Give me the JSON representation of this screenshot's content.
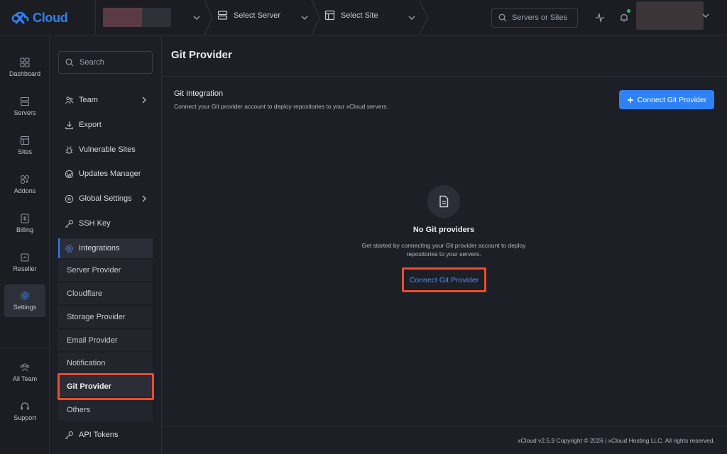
{
  "brand": {
    "name": "Cloud",
    "accent": "#2f82f6"
  },
  "topbar": {
    "server_label": "Select Server",
    "site_label": "Select Site",
    "search_placeholder": "Servers or Sites"
  },
  "rail": {
    "items": [
      {
        "label": "Dashboard",
        "icon": "grid-icon"
      },
      {
        "label": "Servers",
        "icon": "server-icon"
      },
      {
        "label": "Sites",
        "icon": "layout-icon"
      },
      {
        "label": "Addons",
        "icon": "addons-icon"
      },
      {
        "label": "Billing",
        "icon": "billing-icon"
      },
      {
        "label": "Reseller",
        "icon": "reseller-icon"
      },
      {
        "label": "Settings",
        "icon": "gear-icon"
      },
      {
        "label": "All Team",
        "icon": "team-icon"
      },
      {
        "label": "Support",
        "icon": "headset-icon"
      }
    ]
  },
  "sidebar": {
    "search_placeholder": "Search",
    "items": [
      {
        "label": "Team"
      },
      {
        "label": "Export"
      },
      {
        "label": "Vulnerable Sites"
      },
      {
        "label": "Updates Manager"
      },
      {
        "label": "Global Settings"
      },
      {
        "label": "SSH Key"
      },
      {
        "label": "Integrations"
      },
      {
        "label": "API Tokens"
      }
    ],
    "sub_items": [
      {
        "label": "Server Provider"
      },
      {
        "label": "Cloudflare"
      },
      {
        "label": "Storage Provider"
      },
      {
        "label": "Email Provider"
      },
      {
        "label": "Notification"
      },
      {
        "label": "Git Provider"
      },
      {
        "label": "Others"
      }
    ]
  },
  "main": {
    "title": "Git Provider",
    "section_title": "Git Integration",
    "section_desc": "Connect your Git provider account to deploy repositories to your xCloud servers.",
    "connect_button": "Connect Git Provider",
    "empty_title": "No Git providers",
    "empty_desc": "Get started by connecting your Git provider account to deploy repositories to your servers.",
    "empty_link": "Connect Git Provider"
  },
  "footer": {
    "text": "xCloud v2.5.9 Copyright © 2026 | xCloud Hosting LLC. All rights reserved."
  }
}
